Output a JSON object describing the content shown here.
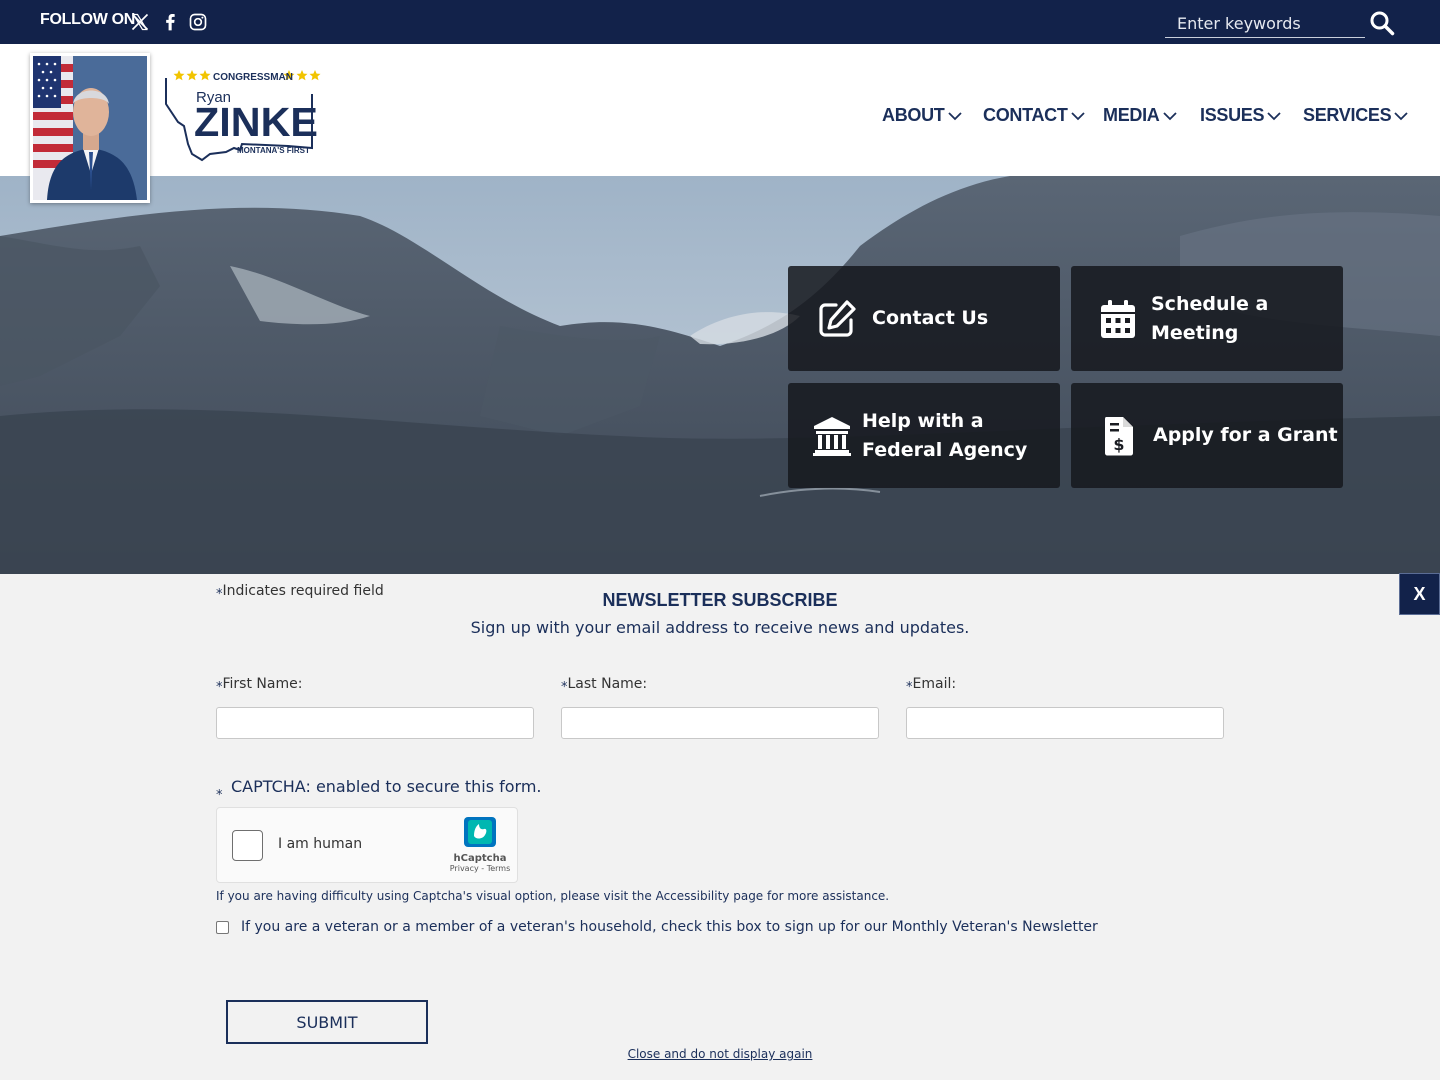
{
  "topbar": {
    "follow_label": "FOLLOW ON",
    "social_icons": [
      "x-icon",
      "facebook-icon",
      "instagram-icon"
    ],
    "search_placeholder": "Enter keywords"
  },
  "header": {
    "logo": {
      "top_line": "CONGRESSMAN",
      "first_name": "Ryan",
      "last_name": "ZINKE",
      "tagline": "MONTANA'S FIRST"
    },
    "nav": [
      "ABOUT",
      "CONTACT",
      "MEDIA",
      "ISSUES",
      "SERVICES"
    ]
  },
  "hero": {
    "tiles": [
      {
        "label": "Contact Us",
        "icon": "edit-icon"
      },
      {
        "label": "Schedule a Meeting",
        "icon": "calendar-icon"
      },
      {
        "label": "Help with a Federal Agency",
        "icon": "government-building-icon"
      },
      {
        "label": "Apply for a Grant",
        "icon": "grant-document-icon"
      }
    ]
  },
  "newsletter": {
    "required_note": "Indicates required field",
    "required_marker": "*",
    "title": "NEWSLETTER SUBSCRIBE",
    "subtitle": "Sign up with your email address to receive news and updates.",
    "fields": [
      {
        "label": "First Name:",
        "value": ""
      },
      {
        "label": "Last Name:",
        "value": ""
      },
      {
        "label": "Email:",
        "value": ""
      }
    ],
    "captcha_label": "CAPTCHA: enabled to secure this form.",
    "captcha_widget": {
      "checkbox_text": "I am human",
      "brand": "hCaptcha",
      "links": "Privacy - Terms"
    },
    "accessibility_note": "If you are having difficulty using Captcha's visual option, please visit the Accessibility page for more assistance.",
    "veteran_text": "If you are a veteran or a member of a veteran's household, check this box to sign up for our Monthly Veteran's Newsletter",
    "submit_label": "SUBMIT",
    "close_link": "Close and do not display again",
    "close_button": "X"
  },
  "colors": {
    "navy": "#12224a",
    "brand_blue": "#1b2f5a",
    "logo_star_gold": "#f2c400",
    "panel_bg": "#f2f2f2"
  }
}
